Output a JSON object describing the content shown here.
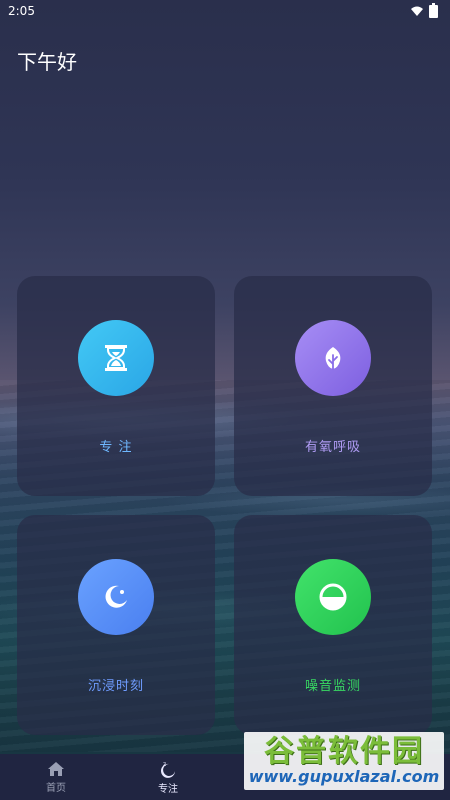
{
  "status_bar": {
    "time": "2:05"
  },
  "greeting": "下午好",
  "cards": [
    {
      "label": "专 注",
      "icon": "hourglass-icon",
      "color": "#2fb3ee",
      "label_color": "#6fb8ff"
    },
    {
      "label": "有氧呼吸",
      "icon": "leaf-icon",
      "color": "#9173ec",
      "label_color": "#b09cf5"
    },
    {
      "label": "沉浸时刻",
      "icon": "moon-icon",
      "color": "#5a8ff8",
      "label_color": "#6f9cff"
    },
    {
      "label": "噪音监测",
      "icon": "half-circle-icon",
      "color": "#30d45a",
      "label_color": "#38d862"
    }
  ],
  "tabbar": {
    "items": [
      {
        "label": "首页",
        "icon": "home-icon",
        "active": false
      },
      {
        "label": "专注",
        "icon": "moon-zz-icon",
        "active": true
      }
    ]
  },
  "watermark": {
    "title": "谷普软件园",
    "url": "www.gupuxlazal.com"
  }
}
